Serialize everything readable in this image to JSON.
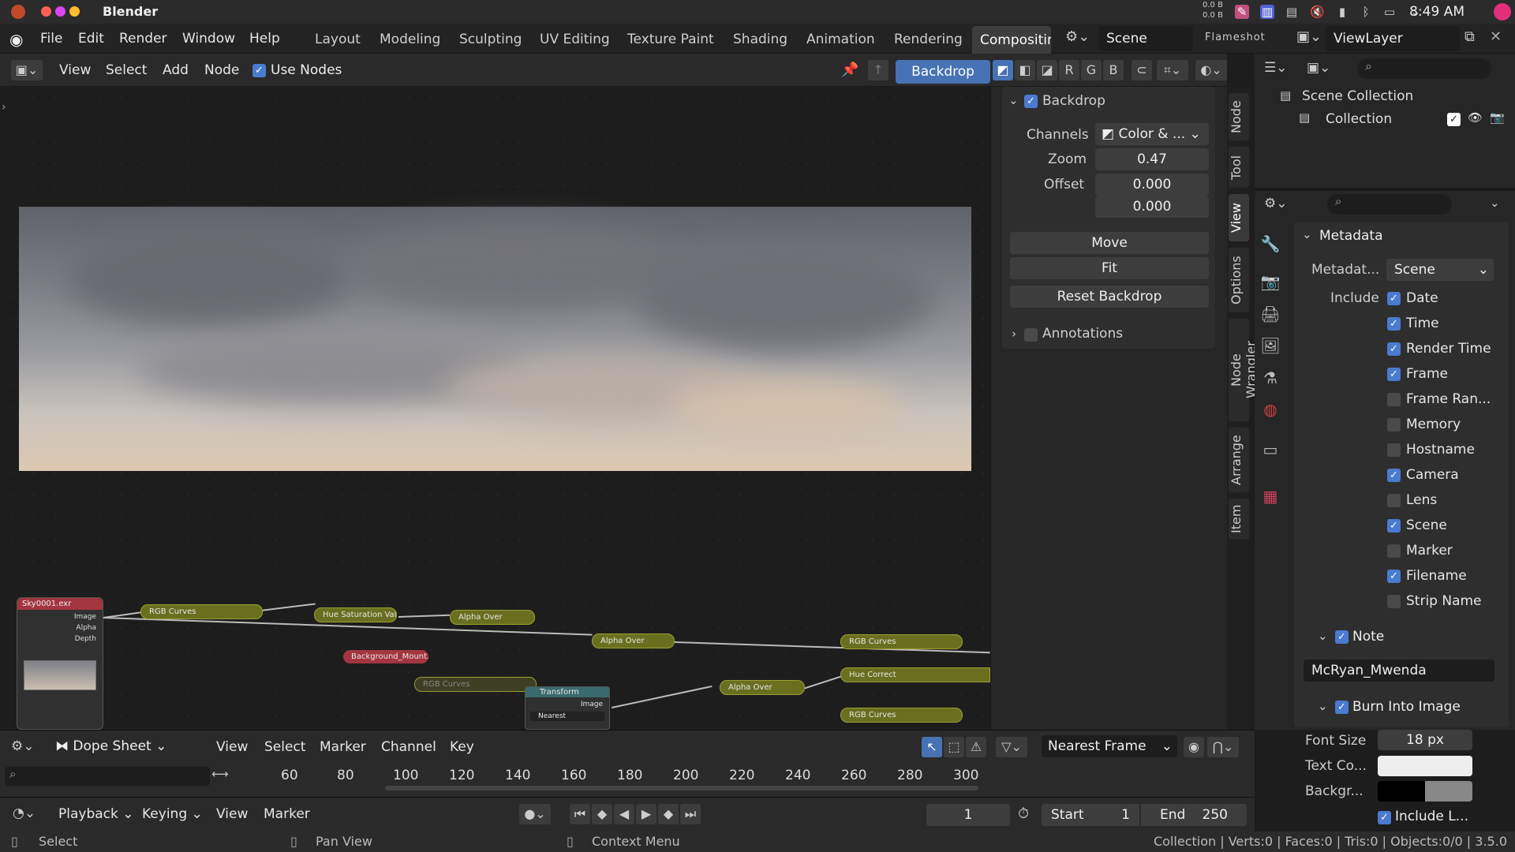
{
  "system": {
    "app_title": "Blender",
    "net_up": "0.0 B",
    "net_down": "0.0 B",
    "time": "8:49 AM"
  },
  "menu": [
    "File",
    "Edit",
    "Render",
    "Window",
    "Help"
  ],
  "workspaces": [
    "Layout",
    "Modeling",
    "Sculpting",
    "UV Editing",
    "Texture Paint",
    "Shading",
    "Animation",
    "Rendering",
    "Compositing"
  ],
  "scene": {
    "scene_name": "Scene",
    "flameshot": "Flameshot",
    "view_layer": "ViewLayer"
  },
  "node_header": {
    "view": "View",
    "select": "Select",
    "add": "Add",
    "node": "Node",
    "use_nodes": "Use Nodes",
    "backdrop": "Backdrop",
    "r": "R",
    "g": "G",
    "b": "B"
  },
  "nodes": {
    "sky": "Sky0001.exr",
    "image": "Image",
    "alpha": "Alpha",
    "depth": "Depth",
    "rgb1": "RGB Curves",
    "hsv": "Hue Saturation Value",
    "alpha1": "Alpha Over",
    "alpha2": "Alpha Over",
    "rgb2": "RGB Curves",
    "bg": "Background_Mount...",
    "rgb3": "RGB Curves",
    "transform": "Transform",
    "t_image": "Image",
    "nearest": "Nearest",
    "alpha3": "Alpha Over",
    "huecorrect": "Hue Correct",
    "rgb4": "RGB Curves"
  },
  "npanel": {
    "backdrop_title": "Backdrop",
    "channels_label": "Channels",
    "channels_value": "Color & ...",
    "zoom_label": "Zoom",
    "zoom_value": "0.47",
    "offset_label": "Offset",
    "offset_x": "0.000",
    "offset_y": "0.000",
    "move": "Move",
    "fit": "Fit",
    "reset": "Reset Backdrop",
    "annotations": "Annotations"
  },
  "tabs": [
    "Node",
    "Tool",
    "View",
    "Options",
    "Node Wrangler",
    "Arrange",
    "Item"
  ],
  "outliner": {
    "scene_collection": "Scene Collection",
    "collection": "Collection"
  },
  "properties": {
    "metadata_title": "Metadata",
    "metadata_label": "Metadat...",
    "metadata_value": "Scene",
    "include_label": "Include",
    "items": [
      {
        "label": "Date",
        "checked": true
      },
      {
        "label": "Time",
        "checked": true
      },
      {
        "label": "Render Time",
        "checked": true
      },
      {
        "label": "Frame",
        "checked": true
      },
      {
        "label": "Frame Ran...",
        "checked": false
      },
      {
        "label": "Memory",
        "checked": false
      },
      {
        "label": "Hostname",
        "checked": false
      },
      {
        "label": "Camera",
        "checked": true
      },
      {
        "label": "Lens",
        "checked": false
      },
      {
        "label": "Scene",
        "checked": true
      },
      {
        "label": "Marker",
        "checked": false
      },
      {
        "label": "Filename",
        "checked": true
      },
      {
        "label": "Strip Name",
        "checked": false
      }
    ],
    "note_label": "Note",
    "note_value": "McRyan_Mwenda",
    "burn_label": "Burn Into Image",
    "font_size_label": "Font Size",
    "font_size_value": "18 px",
    "text_color_label": "Text Co...",
    "background_label": "Backgr...",
    "include_labels": "Include L..."
  },
  "dope": {
    "mode": "Dope Sheet",
    "view": "View",
    "select": "Select",
    "marker": "Marker",
    "channel": "Channel",
    "key": "Key",
    "snap": "Nearest Frame",
    "ticks": [
      "60",
      "80",
      "100",
      "120",
      "140",
      "160",
      "180",
      "200",
      "220",
      "240",
      "260",
      "280",
      "300"
    ]
  },
  "timeline": {
    "playback": "Playback",
    "keying": "Keying",
    "view": "View",
    "marker": "Marker",
    "current_frame": "1",
    "start_label": "Start",
    "start_value": "1",
    "end_label": "End",
    "end_value": "250"
  },
  "status": {
    "select": "Select",
    "pan": "Pan View",
    "context": "Context Menu",
    "stats": "Collection | Verts:0 | Faces:0 | Tris:0 | Objects:0/0 | 3.5.0"
  }
}
